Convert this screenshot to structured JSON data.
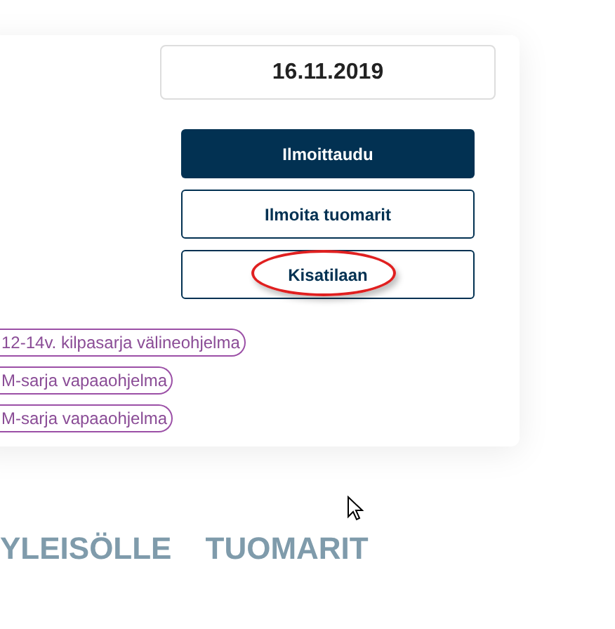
{
  "date": "16.11.2019",
  "buttons": [
    {
      "label": "Ilmoittaudu",
      "kind": "primary",
      "highlighted": false
    },
    {
      "label": "Ilmoita tuomarit",
      "kind": "outline",
      "highlighted": false
    },
    {
      "label": "Kisatilaan",
      "kind": "outline",
      "highlighted": true
    }
  ],
  "tags": [
    "12-14v. kilpasarja välineohjelma",
    "M-sarja vapaaohjelma",
    "M-sarja vapaaohjelma"
  ],
  "nav": [
    "YLEISÖLLE",
    "TUOMARIT"
  ]
}
